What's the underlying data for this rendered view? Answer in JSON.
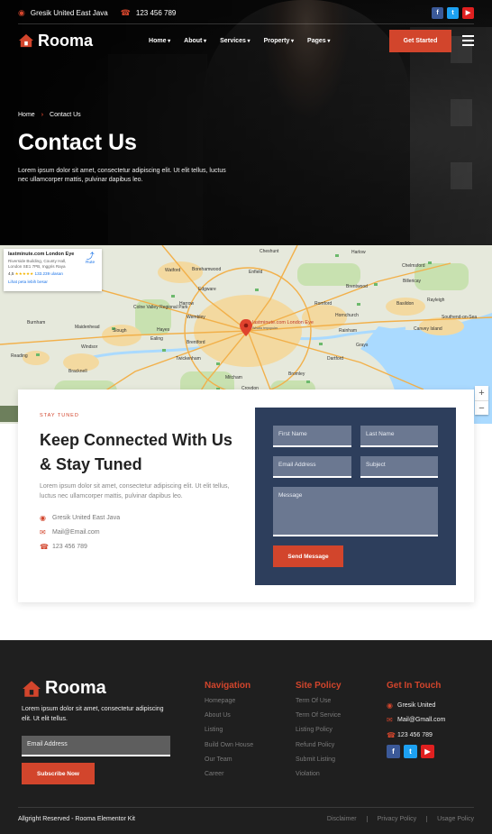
{
  "topbar": {
    "location": "Gresik United East Java",
    "phone": "123 456 789"
  },
  "brand": {
    "name": "Rooma",
    "accent": "#d2452c",
    "navy": "#2d3e5c"
  },
  "nav": {
    "items": [
      "Home",
      "About",
      "Services",
      "Property",
      "Pages"
    ],
    "cta": "Get Started"
  },
  "hero": {
    "breadcrumb": [
      "Home",
      "Contact Us"
    ],
    "title": "Contact Us",
    "text": "Lorem ipsum dolor sit amet, consectetur adipiscing elit. Ut elit tellus, luctus nec ullamcorper mattis, pulvinar dapibus leo."
  },
  "map": {
    "place": "lastminute.com London Eye",
    "address": "Riverside Building, County Hall, London SE1 7PB, Inggris Raya",
    "rating": "4,5",
    "reviews": "133.239 ulasan",
    "route": "Rute",
    "larger": "Lihat peta lebih besar",
    "pin_label": "lastminute.com London Eye",
    "pin_sub": "Wisata terpopuler",
    "labels": [
      "Cheshunt",
      "Watford",
      "Borehamwood",
      "Enfield",
      "Brentwood",
      "Billericay",
      "Rayleigh",
      "Southend-on-Sea",
      "Edgware",
      "Harrow",
      "Romford",
      "Basildon",
      "Wembley",
      "Hornchurch",
      "Maidenhead",
      "Slough",
      "Hayes",
      "Ealing",
      "Brentford",
      "Rainham",
      "Grays",
      "Canvey Island",
      "Reading",
      "Bracknell",
      "Twickenham",
      "Dartford",
      "Mitcham",
      "Croydon",
      "Bromley",
      "Chelmsford",
      "Colne Valley Regional Park",
      "Harlow",
      "Burnham",
      "Windsor"
    ],
    "zoom_in": "+",
    "zoom_out": "−"
  },
  "contact": {
    "eyebrow": "STAY TUNED",
    "title": "Keep Connected With Us & Stay Tuned",
    "text": "Lorem ipsum dolor sit amet, consectetur adipiscing elit. Ut elit tellus, luctus nec ullamcorper mattis, pulvinar dapibus leo.",
    "address": "Gresik United East Java",
    "email": "Mail@Email.com",
    "phone": "123 456 789"
  },
  "form": {
    "first_name": "First Name",
    "last_name": "Last Name",
    "email": "Email Address",
    "subject": "Subject",
    "message": "Message",
    "submit": "Send Message"
  },
  "footer": {
    "about": "Lorem ipsum dolor sit amet, consectetur adipiscing elit. Ut elit tellus.",
    "email_placeholder": "Email Address",
    "subscribe": "Subscribe Now",
    "nav_title": "Navigation",
    "nav_items": [
      "Homepage",
      "About Us",
      "Listing",
      "Build Own House",
      "Our Team",
      "Career"
    ],
    "policy_title": "Site Policy",
    "policy_items": [
      "Term Of Use",
      "Term Of Service",
      "Listing Policy",
      "Refund Policy",
      "Submit Listing",
      "Violation"
    ],
    "touch_title": "Get In Touch",
    "touch_address": "Gresik United",
    "touch_email": "Mail@Gmall.com",
    "touch_phone": "123 456 789",
    "copyright": "Allgright Reserved - Rooma Elementor Kit",
    "legal": [
      "Disclaimer",
      "Privacy Policy",
      "Usage Policy"
    ]
  }
}
